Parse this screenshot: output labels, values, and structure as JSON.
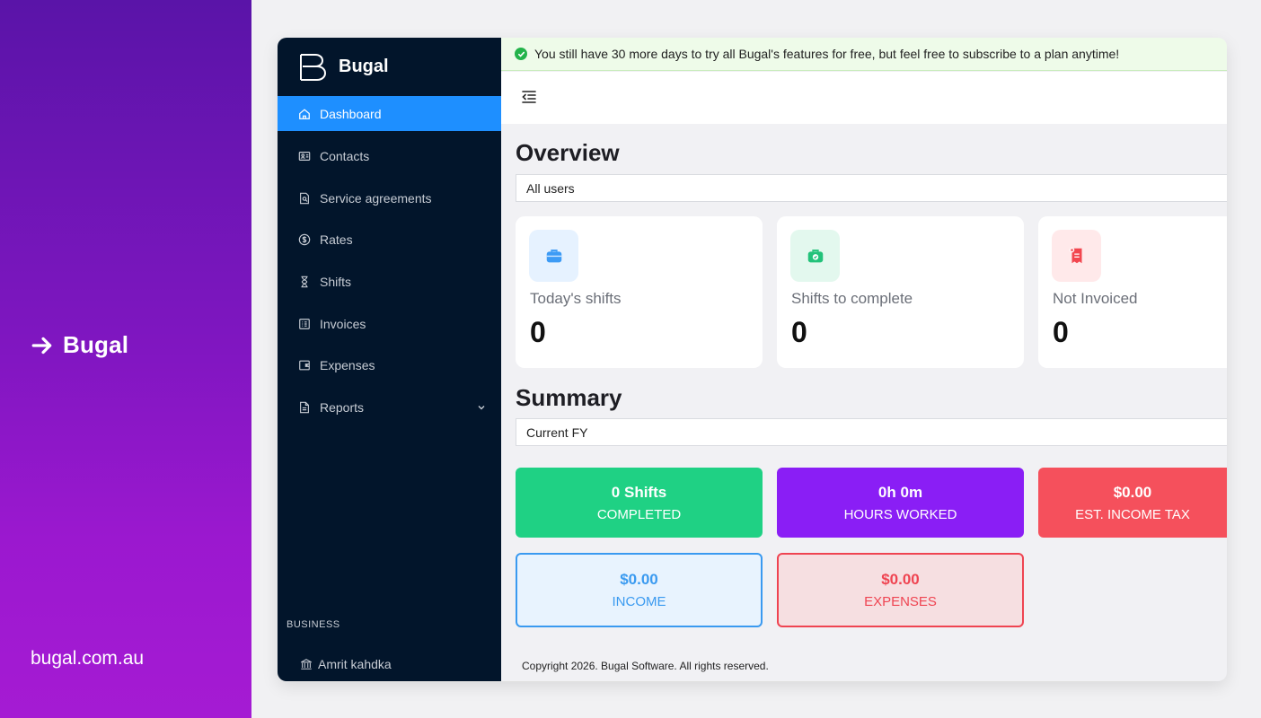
{
  "promo": {
    "brand": "Bugal",
    "url": "bugal.com.au"
  },
  "sidebar": {
    "logo_text": "Bugal",
    "items": [
      {
        "label": "Dashboard",
        "icon": "home-icon"
      },
      {
        "label": "Contacts",
        "icon": "contact-card-icon"
      },
      {
        "label": "Service agreements",
        "icon": "document-search-icon"
      },
      {
        "label": "Rates",
        "icon": "dollar-circle-icon"
      },
      {
        "label": "Shifts",
        "icon": "hourglass-icon"
      },
      {
        "label": "Invoices",
        "icon": "list-icon"
      },
      {
        "label": "Expenses",
        "icon": "wallet-icon"
      },
      {
        "label": "Reports",
        "icon": "file-icon"
      }
    ],
    "active_item": "Dashboard",
    "section_label": "BUSINESS",
    "account_name": "Amrit kahdka"
  },
  "banner": {
    "text": "You still have 30 more days to try all Bugal's features for free, but feel free to subscribe to a plan anytime!"
  },
  "overview": {
    "title": "Overview",
    "filter_value": "All users",
    "cards": [
      {
        "label": "Today's shifts",
        "value": "0",
        "icon": "briefcase-icon"
      },
      {
        "label": "Shifts to complete",
        "value": "0",
        "icon": "briefcase-check-icon"
      },
      {
        "label": "Not Invoiced",
        "value": "0",
        "icon": "invoice-x-icon"
      }
    ]
  },
  "summary": {
    "title": "Summary",
    "period_value": "Current FY",
    "cards": [
      {
        "value": "0 Shifts",
        "label": "COMPLETED"
      },
      {
        "value": "0h 0m",
        "label": "HOURS WORKED"
      },
      {
        "value": "$0.00",
        "label": "EST. INCOME TAX"
      },
      {
        "value": "$0.00",
        "label": "INCOME"
      },
      {
        "value": "$0.00",
        "label": "EXPENSES"
      }
    ]
  },
  "footer": {
    "text": "Copyright 2026. Bugal Software. All rights reserved."
  },
  "colors": {
    "promo_gradient_top": "#5a14a8",
    "promo_gradient_bottom": "#a51bd3",
    "sidebar_bg": "#02152b",
    "active_nav": "#1e8fff",
    "completed": "#1fd184",
    "hours": "#8a1ef5",
    "tax": "#f5505c",
    "income_border": "#3a9af0",
    "expenses_border": "#ef4451"
  }
}
